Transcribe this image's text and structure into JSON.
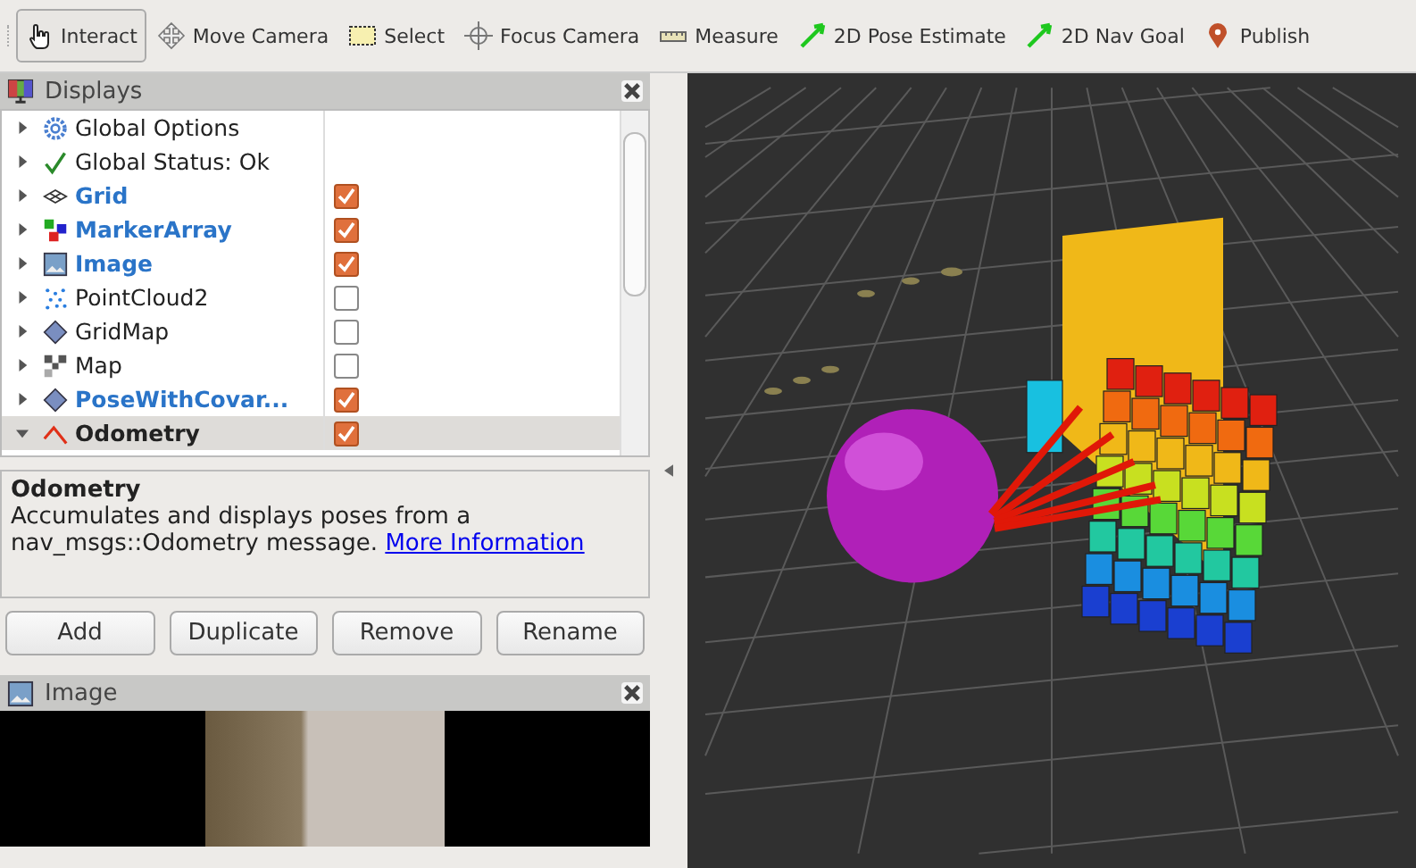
{
  "toolbar": {
    "tools": [
      {
        "kind": "interact",
        "label": "Interact",
        "selected": true
      },
      {
        "kind": "move",
        "label": "Move Camera",
        "selected": false
      },
      {
        "kind": "select",
        "label": "Select",
        "selected": false
      },
      {
        "kind": "focus",
        "label": "Focus Camera",
        "selected": false
      },
      {
        "kind": "measure",
        "label": "Measure",
        "selected": false
      },
      {
        "kind": "pose",
        "label": "2D Pose Estimate",
        "selected": false
      },
      {
        "kind": "goal",
        "label": "2D Nav Goal",
        "selected": false
      },
      {
        "kind": "publish",
        "label": "Publish",
        "selected": false
      }
    ]
  },
  "displays_panel": {
    "title": "Displays",
    "items": [
      {
        "kind": "options",
        "label": "Global Options",
        "expanded": false,
        "selected": false
      },
      {
        "kind": "status",
        "label": "Global Status: Ok",
        "expanded": false,
        "selected": false
      },
      {
        "kind": "grid",
        "label": "Grid",
        "expanded": false,
        "selected": false,
        "checked": true
      },
      {
        "kind": "marker",
        "label": "MarkerArray",
        "expanded": false,
        "selected": false,
        "checked": true
      },
      {
        "kind": "image",
        "label": "Image",
        "expanded": false,
        "selected": false,
        "checked": true
      },
      {
        "kind": "pointcloud",
        "label": "PointCloud2",
        "expanded": false,
        "selected": false,
        "checked": false
      },
      {
        "kind": "gridmap",
        "label": "GridMap",
        "expanded": false,
        "selected": false,
        "checked": false
      },
      {
        "kind": "map",
        "label": "Map",
        "expanded": false,
        "selected": false,
        "checked": false
      },
      {
        "kind": "pose",
        "label": "PoseWithCovar...",
        "expanded": false,
        "selected": false,
        "checked": true
      },
      {
        "kind": "odometry",
        "label": "Odometry",
        "expanded": true,
        "selected": true,
        "checked": true
      }
    ],
    "description": {
      "title": "Odometry",
      "text": "Accumulates and displays poses from a nav_msgs::Odometry message.",
      "link": "More Information"
    },
    "buttons": [
      "Add",
      "Duplicate",
      "Remove",
      "Rename"
    ]
  },
  "image_panel": {
    "title": "Image"
  }
}
